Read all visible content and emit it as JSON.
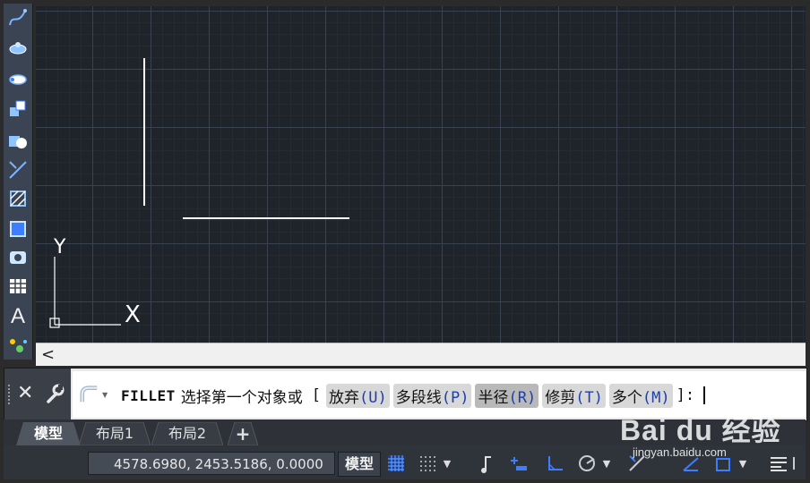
{
  "toolbar": {
    "tools": [
      "spline-icon",
      "revolve-icon",
      "ellipse-icon",
      "block-insert-icon",
      "make-block-icon",
      "point-icon",
      "hatch-icon",
      "gradient-icon",
      "region-icon",
      "table-icon",
      "multiline-text-icon",
      "add-selected-icon"
    ],
    "text_tool": "A"
  },
  "canvas": {
    "ucs_y_label": "Y",
    "ucs_x_label": "X",
    "background": "#1f232a",
    "line_color": "#ffffff"
  },
  "hscroll": {
    "left_arrow": "<"
  },
  "command": {
    "name": "FILLET",
    "prompt": "选择第一个对象或",
    "open_bracket": "[",
    "options": [
      {
        "label": "放弃",
        "key": "(U)"
      },
      {
        "label": "多段线",
        "key": "(P)"
      },
      {
        "label": "半径",
        "key": "(R)"
      },
      {
        "label": "修剪",
        "key": "(T)"
      },
      {
        "label": "多个",
        "key": "(M)"
      }
    ],
    "close": "]:"
  },
  "tabs": {
    "items": [
      "模型",
      "布局1",
      "布局2"
    ],
    "add": "+"
  },
  "status": {
    "coordinates": "4578.6980, 2453.5186, 0.0000",
    "model": "模型"
  },
  "watermark": {
    "logo": "Bai du 经验",
    "url": "jingyan.baidu.com"
  },
  "colors": {
    "accent_blue": "#3d7dff",
    "key_blue": "#1b3fb0",
    "panel": "#3b4453"
  }
}
